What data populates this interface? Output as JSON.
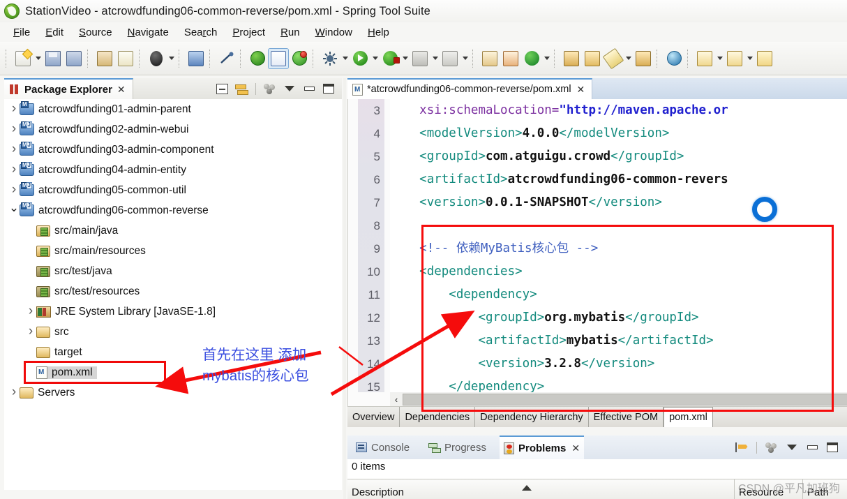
{
  "window": {
    "title": "StationVideo - atcrowdfunding06-common-reverse/pom.xml - Spring Tool Suite",
    "logo_icon": "spring-leaf-icon"
  },
  "menubar": {
    "items": [
      "File",
      "Edit",
      "Source",
      "Navigate",
      "Search",
      "Project",
      "Run",
      "Window",
      "Help"
    ]
  },
  "toolbar": {
    "groups": [
      {
        "items": [
          {
            "name": "new-wizard-icon",
            "dropdown": true
          },
          {
            "name": "save-icon",
            "dropdown": false
          },
          {
            "name": "save-all-icon",
            "dropdown": false
          }
        ]
      },
      {
        "items": [
          {
            "name": "print-icon",
            "dropdown": false
          },
          {
            "name": "link-resource-icon",
            "dropdown": false
          }
        ]
      },
      {
        "items": [
          {
            "name": "search-icon",
            "dropdown": true
          }
        ]
      },
      {
        "items": [
          {
            "name": "open-console-icon",
            "dropdown": false
          }
        ]
      },
      {
        "items": [
          {
            "name": "skip-breakpoints-icon",
            "dropdown": false
          }
        ]
      },
      {
        "items": [
          {
            "name": "restart-server-icon",
            "dropdown": false
          },
          {
            "name": "toggle-markers-icon",
            "dropdown": false
          },
          {
            "name": "refresh-icon",
            "dropdown": false
          }
        ]
      },
      {
        "items": [
          {
            "name": "debug-icon",
            "dropdown": true
          },
          {
            "name": "run-icon",
            "dropdown": true
          },
          {
            "name": "run-error-icon",
            "dropdown": true
          }
        ]
      },
      {
        "items": [
          {
            "name": "stop-icon",
            "dropdown": true
          },
          {
            "name": "profile-icon",
            "dropdown": true
          }
        ]
      },
      {
        "items": [
          {
            "name": "new-java-class-icon",
            "dropdown": false
          },
          {
            "name": "new-table-icon",
            "dropdown": false
          },
          {
            "name": "new-grails-icon",
            "dropdown": true
          }
        ]
      },
      {
        "items": [
          {
            "name": "new-package-icon",
            "dropdown": false
          },
          {
            "name": "open-type-icon",
            "dropdown": false
          },
          {
            "name": "edit-icon",
            "dropdown": true
          },
          {
            "name": "archive-icon",
            "dropdown": false
          }
        ]
      },
      {
        "items": [
          {
            "name": "web-browser-icon",
            "dropdown": false
          }
        ]
      },
      {
        "items": [
          {
            "name": "previous-annotation-icon",
            "dropdown": true
          },
          {
            "name": "next-annotation-icon",
            "dropdown": true
          },
          {
            "name": "back-history-icon",
            "dropdown": false
          }
        ]
      }
    ]
  },
  "package_explorer": {
    "title": "Package Explorer",
    "close_glyph": "✕",
    "toolbar": [
      {
        "name": "collapse-all-icon"
      },
      {
        "name": "link-with-editor-icon"
      },
      {
        "name": "view-menu-filters-icon"
      },
      {
        "name": "view-menu-icon"
      },
      {
        "name": "minimize-view-icon"
      },
      {
        "name": "maximize-view-icon"
      }
    ],
    "tree": [
      {
        "label": "atcrowdfunding01-admin-parent",
        "indent": 0,
        "twisty": "collapsed",
        "icon": "maven-project-icon",
        "selected": false
      },
      {
        "label": "atcrowdfunding02-admin-webui",
        "indent": 0,
        "twisty": "collapsed",
        "icon": "maven-java-project-icon",
        "selected": false
      },
      {
        "label": "atcrowdfunding03-admin-component",
        "indent": 0,
        "twisty": "collapsed",
        "icon": "maven-java-project-icon",
        "selected": false
      },
      {
        "label": "atcrowdfunding04-admin-entity",
        "indent": 0,
        "twisty": "collapsed",
        "icon": "maven-java-project-icon",
        "selected": false
      },
      {
        "label": "atcrowdfunding05-common-util",
        "indent": 0,
        "twisty": "collapsed",
        "icon": "maven-java-project-icon",
        "selected": false
      },
      {
        "label": "atcrowdfunding06-common-reverse",
        "indent": 0,
        "twisty": "expanded",
        "icon": "maven-java-project-icon",
        "selected": false
      },
      {
        "label": "src/main/java",
        "indent": 1,
        "twisty": "none",
        "icon": "source-folder-icon",
        "selected": false
      },
      {
        "label": "src/main/resources",
        "indent": 1,
        "twisty": "none",
        "icon": "source-folder-icon",
        "selected": false
      },
      {
        "label": "src/test/java",
        "indent": 1,
        "twisty": "none",
        "icon": "source-folder-dark-icon",
        "selected": false
      },
      {
        "label": "src/test/resources",
        "indent": 1,
        "twisty": "none",
        "icon": "source-folder-dark-icon",
        "selected": false
      },
      {
        "label": "JRE System Library [JavaSE-1.8]",
        "indent": 1,
        "twisty": "collapsed",
        "icon": "jre-library-icon",
        "selected": false
      },
      {
        "label": "src",
        "indent": 1,
        "twisty": "collapsed",
        "icon": "folder-icon",
        "selected": false
      },
      {
        "label": "target",
        "indent": 1,
        "twisty": "none",
        "icon": "folder-icon",
        "selected": false
      },
      {
        "label": "pom.xml",
        "indent": 1,
        "twisty": "none",
        "icon": "maven-pom-file-icon",
        "selected": true
      },
      {
        "label": "Servers",
        "indent": 0,
        "twisty": "collapsed",
        "icon": "folder-icon",
        "selected": false
      }
    ]
  },
  "editor": {
    "tab_label": "*atcrowdfunding06-common-reverse/pom.xml",
    "tab_icon": "maven-pom-file-icon",
    "close_glyph": "✕",
    "lines": [
      {
        "num": "3",
        "tokens": [
          {
            "t": "    ",
            "c": "p"
          },
          {
            "t": "xsi:schemaLocation=",
            "c": "a"
          },
          {
            "t": "\"http://maven.apache.or",
            "c": "s"
          }
        ]
      },
      {
        "num": "4",
        "tokens": [
          {
            "t": "    ",
            "c": "p"
          },
          {
            "t": "<modelVersion>",
            "c": "k"
          },
          {
            "t": "4.0.0",
            "c": "v"
          },
          {
            "t": "</modelVersion>",
            "c": "k"
          }
        ]
      },
      {
        "num": "5",
        "tokens": [
          {
            "t": "    ",
            "c": "p"
          },
          {
            "t": "<groupId>",
            "c": "k"
          },
          {
            "t": "com.atguigu.crowd",
            "c": "v"
          },
          {
            "t": "</groupId>",
            "c": "k"
          }
        ]
      },
      {
        "num": "6",
        "tokens": [
          {
            "t": "    ",
            "c": "p"
          },
          {
            "t": "<artifactId>",
            "c": "k"
          },
          {
            "t": "atcrowdfunding06-common-revers",
            "c": "v"
          }
        ]
      },
      {
        "num": "7",
        "tokens": [
          {
            "t": "    ",
            "c": "p"
          },
          {
            "t": "<version>",
            "c": "k"
          },
          {
            "t": "0.0.1-SNAPSHOT",
            "c": "v"
          },
          {
            "t": "</version>",
            "c": "k"
          }
        ]
      },
      {
        "num": "8",
        "tokens": []
      },
      {
        "num": "9",
        "tokens": [
          {
            "t": "    ",
            "c": "p"
          },
          {
            "t": "<!-- 依赖MyBatis核心包 -->",
            "c": "cm"
          }
        ]
      },
      {
        "num": "10",
        "tokens": [
          {
            "t": "    ",
            "c": "p"
          },
          {
            "t": "<dependencies>",
            "c": "k"
          }
        ]
      },
      {
        "num": "11",
        "tokens": [
          {
            "t": "        ",
            "c": "p"
          },
          {
            "t": "<dependency>",
            "c": "k"
          }
        ]
      },
      {
        "num": "12",
        "tokens": [
          {
            "t": "            ",
            "c": "p"
          },
          {
            "t": "<groupId>",
            "c": "k"
          },
          {
            "t": "org.mybatis",
            "c": "v"
          },
          {
            "t": "</groupId>",
            "c": "k"
          }
        ]
      },
      {
        "num": "13",
        "tokens": [
          {
            "t": "            ",
            "c": "p"
          },
          {
            "t": "<artifactId>",
            "c": "k"
          },
          {
            "t": "mybatis",
            "c": "v"
          },
          {
            "t": "</artifactId>",
            "c": "k"
          }
        ]
      },
      {
        "num": "14",
        "tokens": [
          {
            "t": "            ",
            "c": "p"
          },
          {
            "t": "<version>",
            "c": "k"
          },
          {
            "t": "3.2.8",
            "c": "v"
          },
          {
            "t": "</version>",
            "c": "k"
          }
        ]
      },
      {
        "num": "15",
        "tokens": [
          {
            "t": "        ",
            "c": "p"
          },
          {
            "t": "</dependency>",
            "c": "k"
          }
        ]
      }
    ],
    "bottom_tabs": [
      {
        "label": "Overview",
        "selected": false
      },
      {
        "label": "Dependencies",
        "selected": false
      },
      {
        "label": "Dependency Hierarchy",
        "selected": false
      },
      {
        "label": "Effective POM",
        "selected": false
      },
      {
        "label": "pom.xml",
        "selected": true
      }
    ],
    "hscroll_left_glyph": "‹"
  },
  "bottom_panel": {
    "tabs": [
      {
        "label": "Console",
        "icon": "console-icon",
        "selected": false
      },
      {
        "label": "Progress",
        "icon": "progress-icon",
        "selected": false
      },
      {
        "label": "Problems",
        "icon": "problems-icon",
        "selected": true
      }
    ],
    "close_glyph": "✕",
    "toolbar": [
      {
        "name": "filters-icon"
      },
      {
        "name": "view-menu-filters-icon"
      },
      {
        "name": "view-menu-icon"
      },
      {
        "name": "minimize-view-icon"
      },
      {
        "name": "maximize-view-icon"
      }
    ],
    "items_count": "0 items",
    "columns": [
      "Description",
      "Resource",
      "Path"
    ]
  },
  "annotations": {
    "note_line1": "首先在这里 添加",
    "note_line2": "mybatis的核心包",
    "note_color": "#3b4fe0",
    "highlight_color": "#f50c0c",
    "cursor_ring_color": "#0a6fd6"
  },
  "watermark": "CSDN @平凡加班狗"
}
